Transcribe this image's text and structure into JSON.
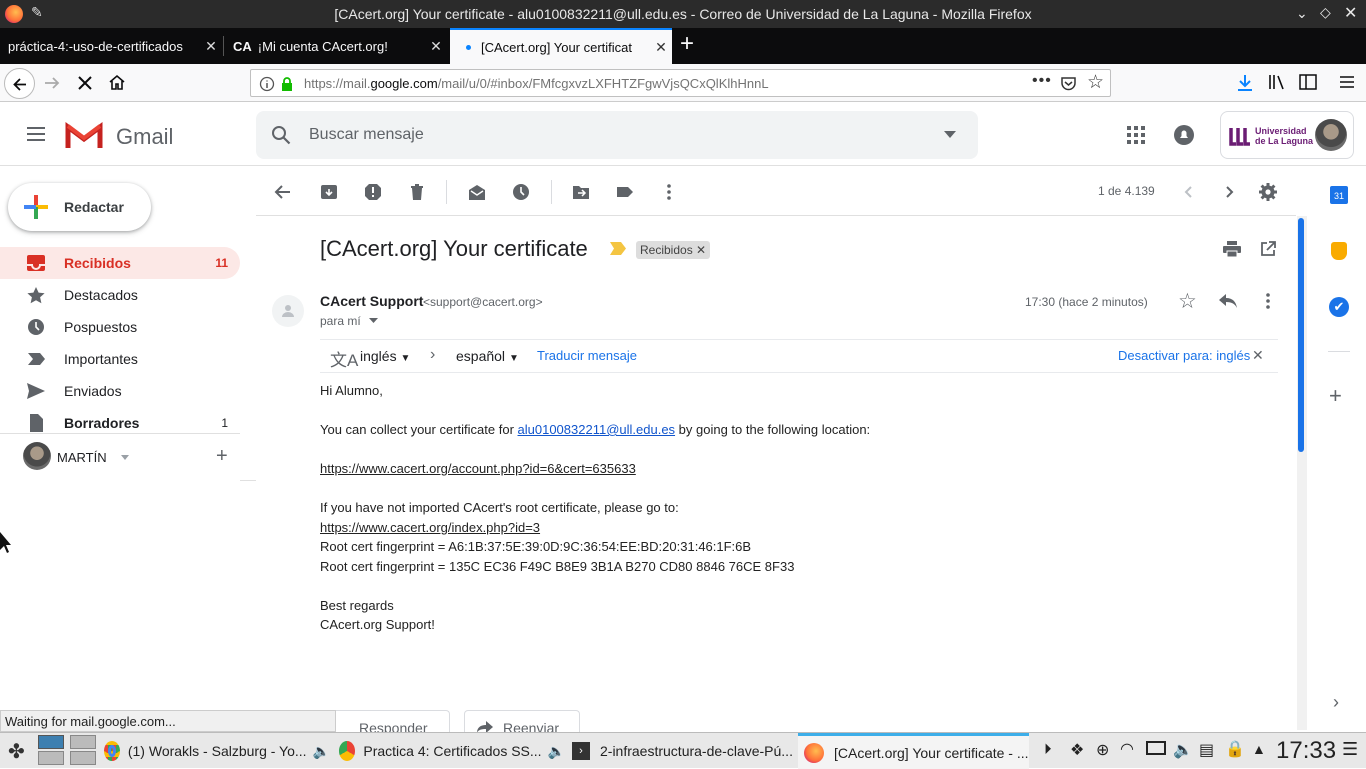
{
  "window": {
    "title": "[CAcert.org] Your certificate - alu0100832211@ull.edu.es - Correo de Universidad de La Laguna - Mozilla Firefox"
  },
  "tabs": [
    {
      "label": "práctica-4:-uso-de-certificados",
      "icon": "firefox-page-icon"
    },
    {
      "label": "¡Mi cuenta CAcert.org!",
      "icon": "CA"
    },
    {
      "label": "[CAcert.org] Your certificat",
      "icon": "loading-dot-icon"
    }
  ],
  "url": {
    "prefix": "https://mail.",
    "host": "google.com",
    "rest": "/mail/u/0/#inbox/FMfcgxvzLXFHTZFgwVjsQCxQlKlhHnnL"
  },
  "gmail": {
    "logo_text": "Gmail",
    "search_placeholder": "Buscar mensaje",
    "org_name_line1": "Universidad",
    "org_name_line2": "de La Laguna",
    "compose_label": "Redactar",
    "nav": [
      {
        "label": "Recibidos",
        "count": "11",
        "icon": "inbox-icon"
      },
      {
        "label": "Destacados",
        "count": "",
        "icon": "star-icon"
      },
      {
        "label": "Pospuestos",
        "count": "",
        "icon": "clock-icon"
      },
      {
        "label": "Importantes",
        "count": "",
        "icon": "important-icon"
      },
      {
        "label": "Enviados",
        "count": "",
        "icon": "send-icon"
      },
      {
        "label": "Borradores",
        "count": "1",
        "icon": "draft-icon"
      }
    ],
    "hangouts_user": "MARTÍN",
    "pagination": "1 de 4.139"
  },
  "message": {
    "subject": "[CAcert.org] Your certificate",
    "label_chip": "Recibidos",
    "sender_name": "CAcert Support",
    "sender_email": "<support@cacert.org>",
    "to": "para mí",
    "time": "17:30 (hace 2 minutos)",
    "translate": {
      "from": "inglés",
      "to": "español",
      "action": "Traducir mensaje",
      "disable": "Desactivar para: inglés"
    },
    "greeting": "Hi Alumno,",
    "line1_before": "You can collect your certificate for ",
    "line1_link": "alu0100832211@ull.edu.es",
    "line1_after": " by going to the following location:",
    "cert_link": "https://www.cacert.org/account.php?id=6&cert=635633",
    "root_intro": "If you have not imported CAcert's root certificate, please go to:",
    "root_link": "https://www.cacert.org/index.php?id=3",
    "fp1": "Root cert fingerprint = A6:1B:37:5E:39:0D:9C:36:54:EE:BD:20:31:46:1F:6B",
    "fp2": "Root cert fingerprint = 135C EC36 F49C B8E9 3B1A B270 CD80 8846 76CE 8F33",
    "regards": "Best regards",
    "signature": "CAcert.org Support!",
    "reply_btn": "Responder",
    "forward_btn": "Reenviar"
  },
  "status": "Waiting for mail.google.com...",
  "taskbar": {
    "tasks": [
      "(1) Worakls - Salzburg - Yo...",
      "Practica 4: Certificados SS...",
      "2-infraestructura-de-clave-Pú...",
      "[CAcert.org] Your certificate - ..."
    ],
    "clock": "17:33"
  },
  "calendar_day": "31"
}
